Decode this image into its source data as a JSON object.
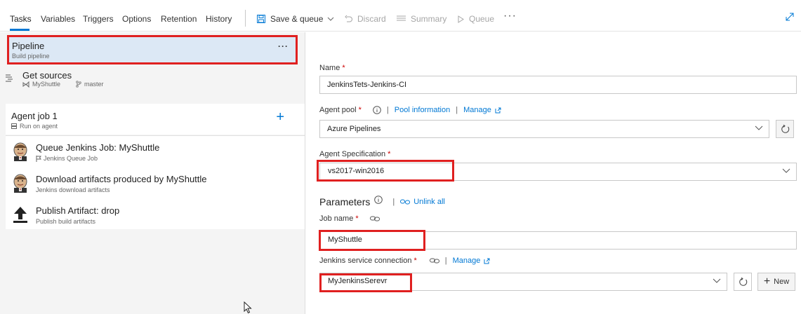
{
  "toolbar": {
    "tabs": [
      "Tasks",
      "Variables",
      "Triggers",
      "Options",
      "Retention",
      "History"
    ],
    "save_queue": "Save & queue",
    "discard": "Discard",
    "summary": "Summary",
    "queue": "Queue",
    "more": "···"
  },
  "left": {
    "pipeline": {
      "title": "Pipeline",
      "subtitle": "Build pipeline",
      "menu": "···"
    },
    "get_sources": {
      "title": "Get sources",
      "repo": "MyShuttle",
      "branch": "master"
    },
    "agent_job": {
      "title": "Agent job 1",
      "subtitle": "Run on agent",
      "add": "+"
    },
    "tasks": [
      {
        "title": "Queue Jenkins Job: MyShuttle",
        "subtitle": "Jenkins Queue Job",
        "icon": "jenkins-icon"
      },
      {
        "title": "Download artifacts produced by MyShuttle",
        "subtitle": "Jenkins download artifacts",
        "icon": "jenkins-icon"
      },
      {
        "title": "Publish Artifact: drop",
        "subtitle": "Publish build artifacts",
        "icon": "upload-arrow-icon"
      }
    ]
  },
  "right": {
    "name": {
      "label": "Name",
      "required": "*",
      "value": "JenkinsTets-Jenkins-CI"
    },
    "agent_pool": {
      "label": "Agent pool",
      "required": "*",
      "pool_info": "Pool information",
      "manage": "Manage",
      "value": "Azure Pipelines"
    },
    "agent_spec": {
      "label": "Agent Specification",
      "required": "*",
      "value": "vs2017-win2016"
    },
    "parameters": {
      "title": "Parameters",
      "unlink": "Unlink all"
    },
    "job_name": {
      "label": "Job name",
      "required": "*",
      "value": "MyShuttle"
    },
    "jenkins_conn": {
      "label": "Jenkins service connection",
      "required": "*",
      "manage": "Manage",
      "value": "MyJenkinsSerevr",
      "new": "New"
    }
  },
  "colors": {
    "accent": "#0078d4",
    "highlight": "#e02020",
    "selected_bg": "#dce8f5"
  }
}
